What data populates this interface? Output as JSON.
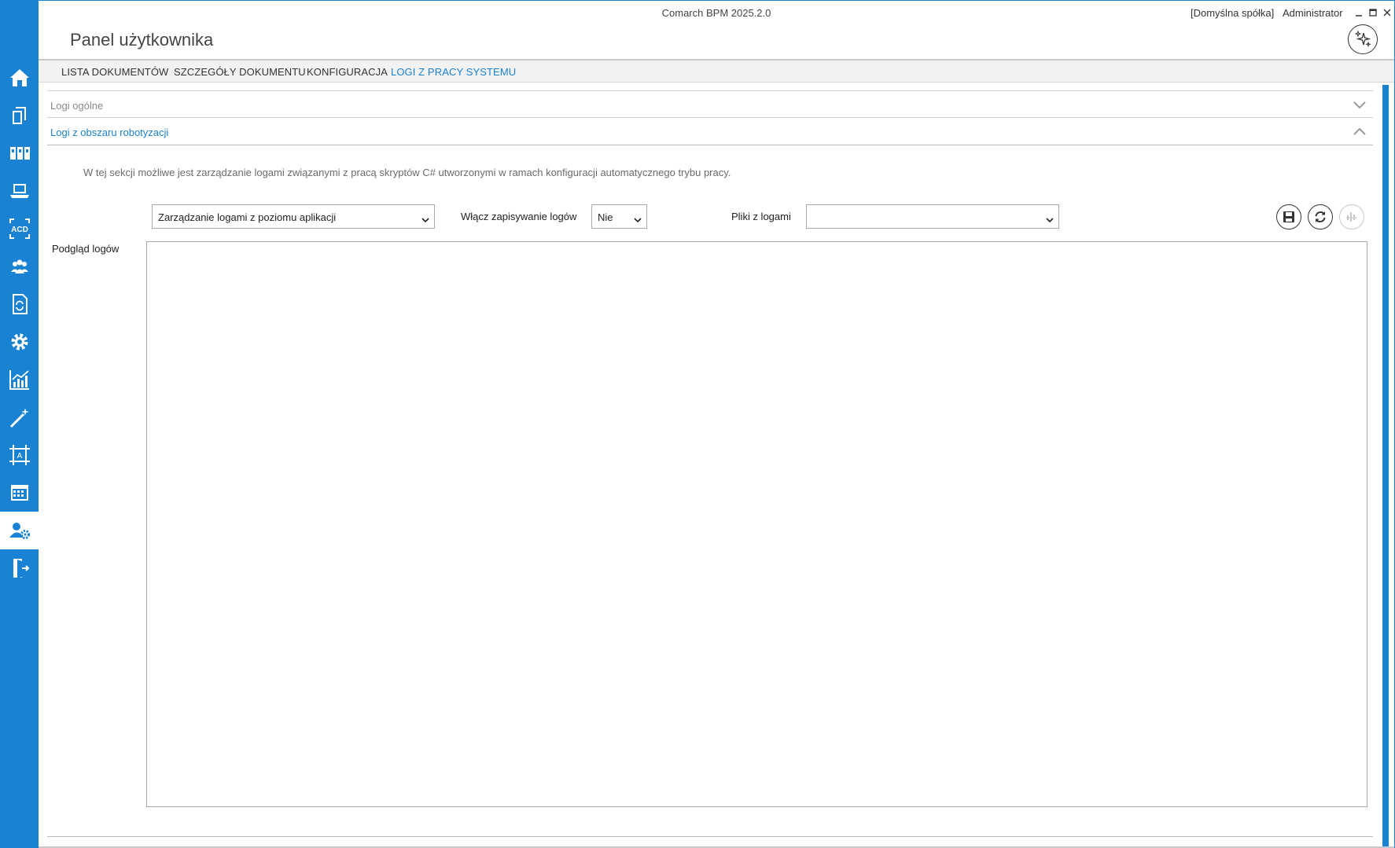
{
  "window": {
    "app_title": "Comarch BPM 2025.2.0",
    "company": "[Domyślna spółka]",
    "user": "Administrator"
  },
  "page": {
    "title": "Panel użytkownika"
  },
  "tabs": [
    {
      "label": "LISTA DOKUMENTÓW",
      "active": false
    },
    {
      "label": "SZCZEGÓŁY DOKUMENTU",
      "active": false
    },
    {
      "label": "KONFIGURACJA",
      "active": false
    },
    {
      "label": "LOGI Z PRACY SYSTEMU",
      "active": true
    }
  ],
  "sidebar": {
    "items": [
      {
        "icon": "home-icon"
      },
      {
        "icon": "documents-icon"
      },
      {
        "icon": "library-icon"
      },
      {
        "icon": "laptop-icon"
      },
      {
        "icon": "acd-icon",
        "text": "ACD"
      },
      {
        "icon": "users-icon"
      },
      {
        "icon": "document-sync-icon"
      },
      {
        "icon": "gear-icon"
      },
      {
        "icon": "chart-icon"
      },
      {
        "icon": "magic-wand-icon"
      },
      {
        "icon": "designer-icon",
        "text": "A"
      },
      {
        "icon": "calendar-icon"
      },
      {
        "icon": "user-settings-icon",
        "active": true
      },
      {
        "icon": "exit-icon"
      }
    ]
  },
  "sections": {
    "general_logs": {
      "title": "Logi ogólne",
      "expanded": false
    },
    "robotization_logs": {
      "title": "Logi z obszaru robotyzacji",
      "expanded": true,
      "description": "W tej sekcji możliwe jest zarządzanie logami związanymi z pracą skryptów C# utworzonymi w ramach konfiguracji automatycznego trybu pracy.",
      "mode_select": {
        "value": "Zarządzanie logami z poziomu aplikacji"
      },
      "save_logs": {
        "label": "Włącz zapisywanie logów",
        "value": "Nie"
      },
      "log_files": {
        "label": "Pliki z logami",
        "value": ""
      },
      "preview": {
        "label": "Podgląd logów",
        "content": ""
      },
      "buttons": {
        "save": {
          "icon": "save-icon",
          "enabled": true
        },
        "refresh": {
          "icon": "refresh-icon",
          "enabled": true
        },
        "stats": {
          "icon": "stats-icon",
          "enabled": false
        }
      }
    }
  },
  "colors": {
    "accent": "#1a82d2",
    "muted_text": "#8a8a8a",
    "disabled": "#c8c8c8"
  }
}
